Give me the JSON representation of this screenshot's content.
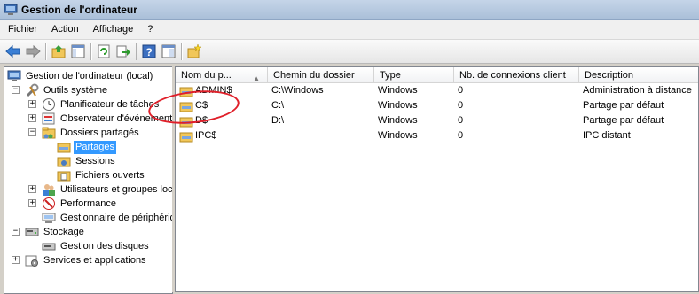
{
  "window": {
    "title": "Gestion de l'ordinateur"
  },
  "menu": [
    "Fichier",
    "Action",
    "Affichage",
    "?"
  ],
  "toolbar": [
    "back-icon",
    "forward-icon",
    "up-icon",
    "show-hide-tree-icon",
    "refresh-icon",
    "export-icon",
    "help-icon",
    "properties-icon",
    "new-share-icon"
  ],
  "tree": {
    "root": "Gestion de l'ordinateur (local)",
    "tools": "Outils système",
    "scheduler": "Planificateur de tâches",
    "events": "Observateur d'événements",
    "shared": "Dossiers partagés",
    "shares": "Partages",
    "sessions": "Sessions",
    "openfiles": "Fichiers ouverts",
    "users": "Utilisateurs et groupes locaux",
    "perf": "Performance",
    "devmgr": "Gestionnaire de périphériques",
    "storage": "Stockage",
    "disks": "Gestion des disques",
    "services": "Services et applications"
  },
  "columns": [
    "Nom du p...",
    "Chemin du dossier",
    "Type",
    "Nb. de connexions client",
    "Description"
  ],
  "shares": [
    {
      "name": "ADMIN$",
      "path": "C:\\Windows",
      "type": "Windows",
      "connections": "0",
      "description": "Administration à distance"
    },
    {
      "name": "C$",
      "path": "C:\\",
      "type": "Windows",
      "connections": "0",
      "description": "Partage par défaut"
    },
    {
      "name": "D$",
      "path": "D:\\",
      "type": "Windows",
      "connections": "0",
      "description": "Partage par défaut"
    },
    {
      "name": "IPC$",
      "path": "",
      "type": "Windows",
      "connections": "0",
      "description": "IPC distant"
    }
  ],
  "colors": {
    "selection": "#3399ff",
    "annotation": "#e0202a"
  }
}
